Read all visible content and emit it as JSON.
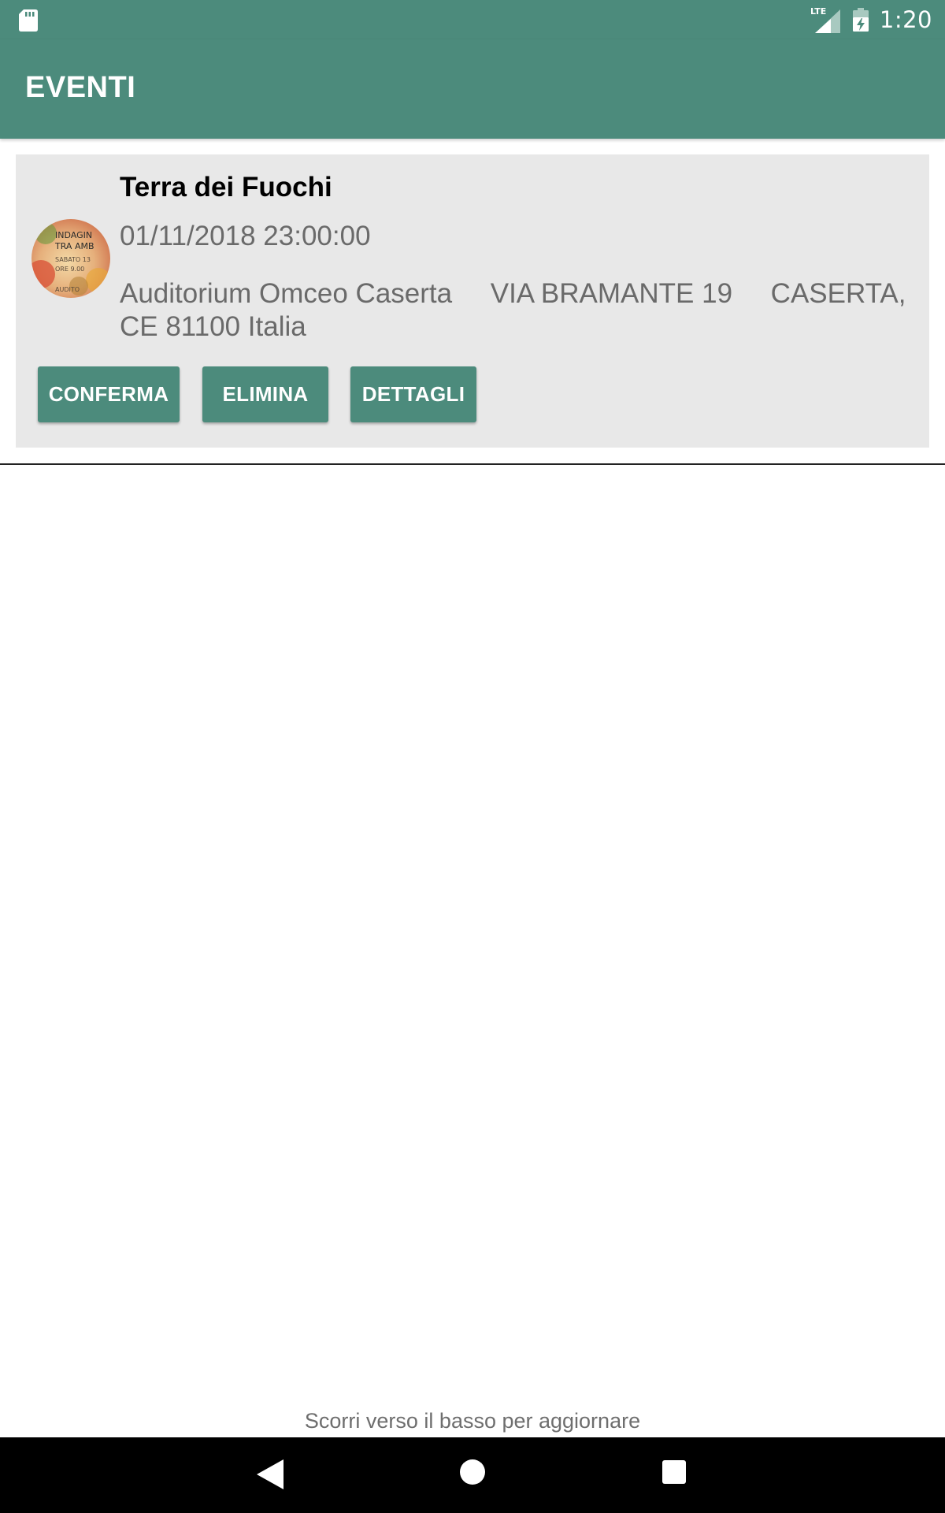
{
  "status_bar": {
    "time": "1:20",
    "network": "LTE",
    "sd_icon": "sd-card-icon",
    "signal_icon": "signal-icon",
    "battery_icon": "battery-charging-icon"
  },
  "app_bar": {
    "title": "EVENTI",
    "color": "#4c8b7c"
  },
  "events": [
    {
      "title": "Terra dei Fuochi",
      "datetime": "01/11/2018 23:00:00",
      "location": "Auditorium Omceo Caserta     VIA BRAMANTE 19     CASERTA, CE 81100 Italia",
      "thumbnail_text": "INDAGIN TRA AMB SABATO 13 ORE 9.00 AUDITO",
      "buttons": {
        "confirm": "CONFERMA",
        "delete": "ELIMINA",
        "details": "DETTAGLI"
      }
    }
  ],
  "refresh_hint": "Scorri verso il basso per aggiornare",
  "nav_bar": {
    "back_icon": "back-triangle-icon",
    "home_icon": "home-circle-icon",
    "recent_icon": "recent-apps-square-icon"
  }
}
